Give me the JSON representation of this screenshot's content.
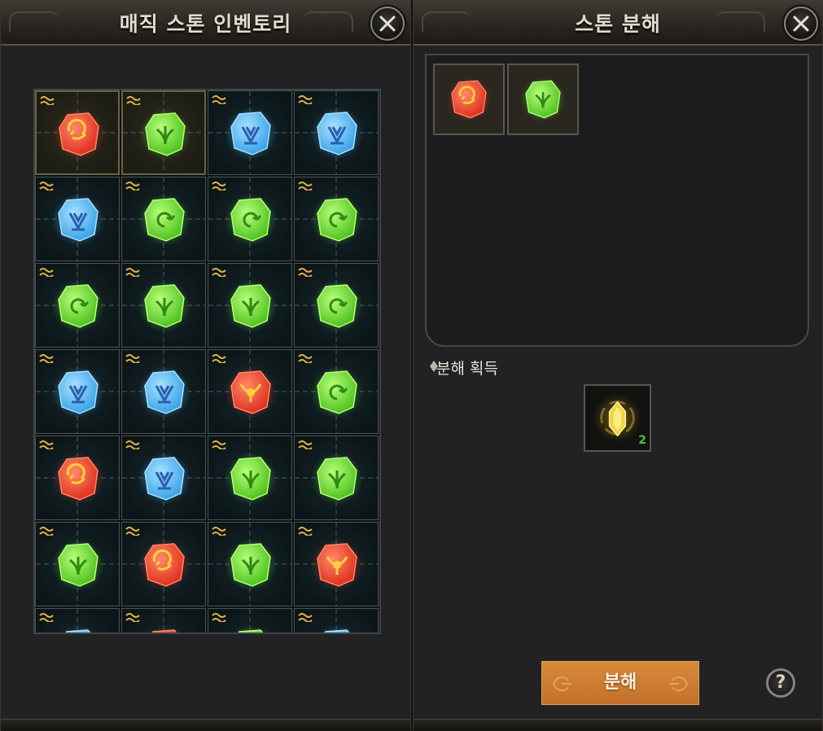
{
  "inventory": {
    "title": "매직 스톤 인벤토리",
    "rank_icon": "double-wave-rank-icon",
    "grid": [
      [
        "red-round",
        "green-leaf",
        "blue-crown",
        "blue-crown"
      ],
      [
        "blue-crown",
        "green-spiral",
        "green-spiral",
        "green-spiral"
      ],
      [
        "green-spiral",
        "green-leaf",
        "green-leaf",
        "green-spiral"
      ],
      [
        "blue-crown",
        "blue-crown",
        "red-horn",
        "green-spiral"
      ],
      [
        "red-round",
        "blue-crown",
        "green-leaf",
        "green-leaf"
      ],
      [
        "green-leaf",
        "red-round",
        "green-leaf",
        "red-horn"
      ],
      [
        "blue-crown",
        "red-round",
        "green-leaf",
        "blue-crown"
      ]
    ],
    "selected": [
      [
        0,
        0
      ],
      [
        0,
        1
      ]
    ]
  },
  "decompose": {
    "title": "스톤 분해",
    "slots": [
      "red-round",
      "green-leaf"
    ],
    "result_label": "분해 획득",
    "reward": {
      "item": "yellow-crystal",
      "count": "2"
    },
    "button_label": "분해",
    "help_label": "?"
  },
  "colors": {
    "red": "#e0301e",
    "green": "#4fc21f",
    "blue": "#3aa3e8",
    "button": "#d07e34"
  }
}
